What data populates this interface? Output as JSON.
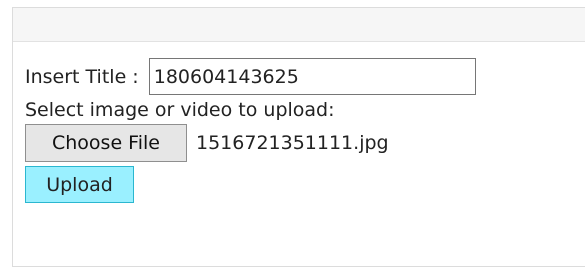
{
  "form": {
    "title_label": "Insert Title : ",
    "title_value": "180604143625",
    "select_label": "Select image or video to upload:",
    "choose_file_label": "Choose File",
    "selected_file_name": "1516721351111.jpg",
    "upload_label": "Upload"
  },
  "colors": {
    "upload_button_bg": "#9af0ff",
    "upload_button_border": "#2bb7d0",
    "choose_button_bg": "#e6e6e6",
    "panel_header_bg": "#f6f6f6"
  }
}
